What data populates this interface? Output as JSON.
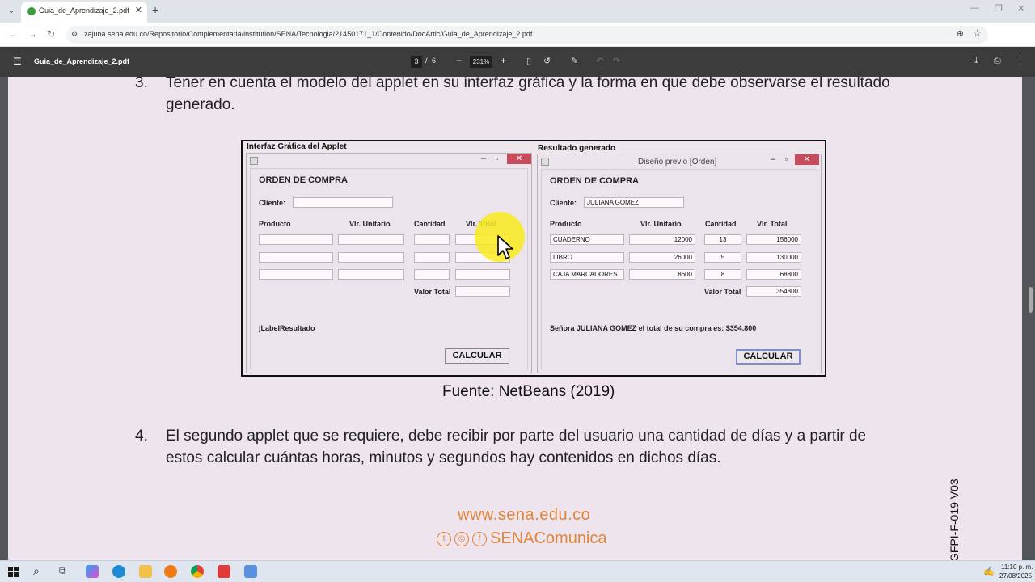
{
  "browser": {
    "tab_title": "Guia_de_Aprendizaje_2.pdf",
    "url": "zajuna.sena.edu.co/Repositorio/Complementaria/institution/SENA/Tecnologia/21450171_1/Contenido/DocArtic/Guia_de_Aprendizaje_2.pdf"
  },
  "pdf_toolbar": {
    "file_name": "Guia_de_Aprendizaje_2.pdf",
    "current_page": "3",
    "separator": "/",
    "total_pages": "6",
    "zoom": "231%"
  },
  "document": {
    "item3": {
      "num": "3.",
      "line1": "Tener en cuenta el modelo del applet en su interfaz gráfica y la forma en que debe observarse el resultado",
      "line2": "generado."
    },
    "figure": {
      "left_caption": "Interfaz Gráfica del Applet",
      "right_caption": "Resultado generado",
      "left_window": {
        "heading": "ORDEN DE COMPRA",
        "cliente_label": "Cliente:",
        "cliente_value": "",
        "col_producto": "Producto",
        "col_unitario": "Vlr. Unitario",
        "col_cantidad": "Cantidad",
        "col_total": "Vlr. Total",
        "valor_total_label": "Valor Total",
        "result_label": "jLabelResultado",
        "button": "CALCULAR"
      },
      "right_window": {
        "title": "Diseño previo [Orden]",
        "heading": "ORDEN DE COMPRA",
        "cliente_label": "Cliente:",
        "cliente_value": "JULIANA GOMEZ",
        "col_producto": "Producto",
        "col_unitario": "Vlr. Unitario",
        "col_cantidad": "Cantidad",
        "col_total": "Vlr. Total",
        "rows": [
          {
            "producto": "CUADERNO",
            "unitario": "12000",
            "cantidad": "13",
            "total": "156000"
          },
          {
            "producto": "LIBRO",
            "unitario": "26000",
            "cantidad": "5",
            "total": "130000"
          },
          {
            "producto": "CAJA MARCADORES",
            "unitario": "8600",
            "cantidad": "8",
            "total": "68800"
          }
        ],
        "valor_total_label": "Valor Total",
        "valor_total_value": "354800",
        "result_text": "Señora JULIANA GOMEZ el total de su compra es: $354.800",
        "button": "CALCULAR"
      }
    },
    "figure_source": "Fuente: NetBeans (2019)",
    "item4": {
      "num": "4.",
      "line1": "El segundo applet que se requiere, debe recibir por parte del usuario una cantidad de días y a partir de",
      "line2": "estos calcular cuántas horas, minutos y segundos hay contenidos en dichos días."
    },
    "footer_url": "www.sena.edu.co",
    "footer_social": "SENAComunica",
    "version_code": "GFPI-F-019 V03"
  },
  "taskbar": {
    "time": "11:10 p. m.",
    "date": "27/08/2025"
  }
}
